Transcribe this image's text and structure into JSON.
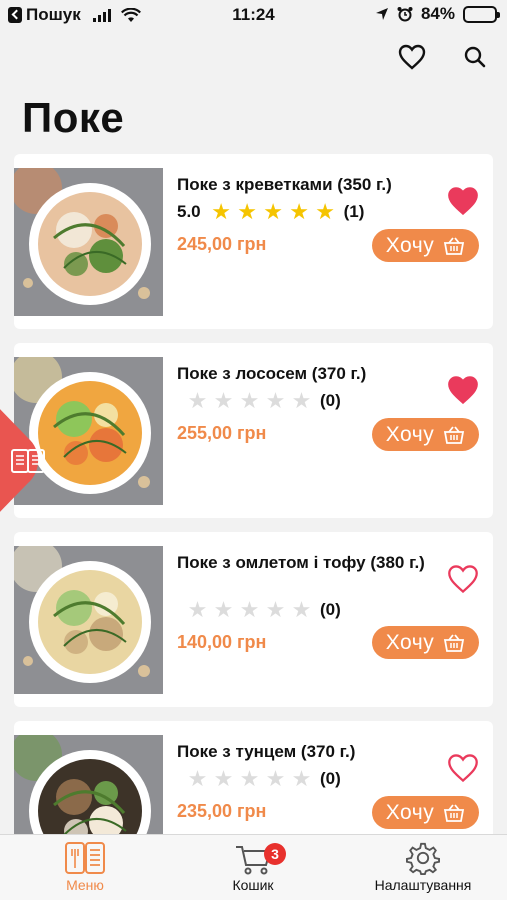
{
  "status_bar": {
    "back_label": "Пошук",
    "time": "11:24",
    "battery": "84%"
  },
  "page": {
    "title": "Поке"
  },
  "colors": {
    "accent": "#f08a4a",
    "favorite": "#ea3a5c",
    "star_filled": "#f5c400",
    "star_empty": "#dcdcdc"
  },
  "products": [
    {
      "name": "Поке з креветками (350 г.)",
      "score": "5.0",
      "stars_filled": 5,
      "rating_count": "(1)",
      "price": "245,00 грн",
      "favorite": true,
      "button": "Хочу"
    },
    {
      "name": "Поке з лососем (370 г.)",
      "score": "",
      "stars_filled": 0,
      "rating_count": "(0)",
      "price": "255,00 грн",
      "favorite": true,
      "button": "Хочу"
    },
    {
      "name": "Поке з омлетом і тофу (380 г.)",
      "score": "",
      "stars_filled": 0,
      "rating_count": "(0)",
      "price": "140,00 грн",
      "favorite": false,
      "button": "Хочу"
    },
    {
      "name": "Поке з тунцем (370 г.)",
      "score": "",
      "stars_filled": 0,
      "rating_count": "(0)",
      "price": "235,00 грн",
      "favorite": false,
      "button": "Хочу"
    }
  ],
  "bottom_nav": {
    "menu": "Меню",
    "cart": "Кошик",
    "cart_badge": "3",
    "settings": "Налаштування"
  },
  "icons": [
    "heart-icon",
    "search-icon",
    "star-icon",
    "basket-icon",
    "menu-book-icon",
    "cart-icon",
    "gear-icon"
  ]
}
